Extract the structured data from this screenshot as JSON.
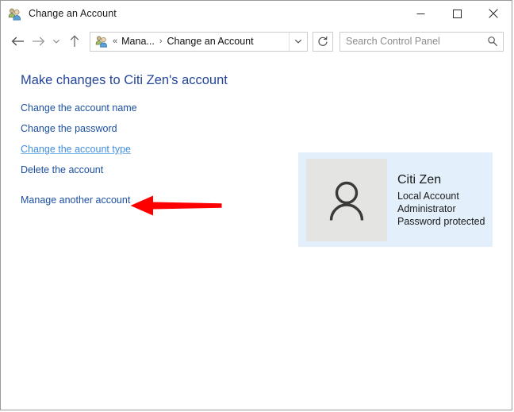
{
  "window": {
    "title": "Change an Account",
    "icon": "user-accounts-icon",
    "minimize_label": "Minimize",
    "maximize_label": "Maximize",
    "close_label": "Close"
  },
  "navbar": {
    "back_label": "Back",
    "forward_label": "Forward",
    "recent_label": "Recent locations",
    "up_label": "Up",
    "refresh_label": "Refresh",
    "breadcrumb": {
      "icon": "user-accounts-icon",
      "overflow": "«",
      "separator": "›",
      "items": [
        {
          "label": "Mana...",
          "truncated": true
        },
        {
          "label": "Change an Account",
          "truncated": false
        }
      ]
    },
    "search": {
      "placeholder": "Search Control Panel",
      "value": "",
      "icon": "search-icon"
    }
  },
  "main": {
    "page_title": "Make changes to Citi Zen's account",
    "tasks": [
      {
        "label": "Change the account name",
        "hovered": false
      },
      {
        "label": "Change the password",
        "hovered": false
      },
      {
        "label": "Change the account type",
        "hovered": true
      },
      {
        "label": "Delete the account",
        "hovered": false
      },
      {
        "label": "Manage another account",
        "hovered": false
      }
    ],
    "account": {
      "avatar_icon": "person-icon",
      "name": "Citi Zen",
      "details": [
        "Local Account",
        "Administrator",
        "Password protected"
      ]
    },
    "annotation": {
      "type": "arrow",
      "direction": "left",
      "color": "#fe0000",
      "points_to": "Change the account type"
    }
  },
  "colors": {
    "accent_link": "#1c4fa1",
    "hover_link": "#3f8ee0",
    "heading": "#23469a",
    "panel_background": "#e3f0fb",
    "avatar_background": "#e4e4e2",
    "annotation": "#fe0000",
    "window_border": "#9a9a9a"
  }
}
